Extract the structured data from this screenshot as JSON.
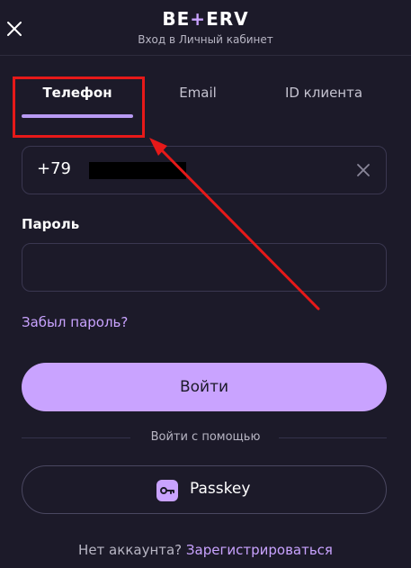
{
  "header": {
    "logo_text_left": "BE",
    "logo_plus": "+",
    "logo_text_right": "ERV",
    "subtitle": "Вход в Личный кабинет"
  },
  "tabs": [
    {
      "label": "Телефон",
      "active": true
    },
    {
      "label": "Email",
      "active": false
    },
    {
      "label": "ID клиента",
      "active": false
    }
  ],
  "phone": {
    "prefix": "+79"
  },
  "password": {
    "label": "Пароль",
    "value": ""
  },
  "forgot_link": "Забыл пароль?",
  "login_button": "Войти",
  "divider_text": "Войти с помощью",
  "passkey_button": "Passkey",
  "footer": {
    "question": "Нет аккаунта?",
    "link": "Зарегистрироваться"
  },
  "colors": {
    "accent": "#c9a3ff",
    "background": "#1c1a29",
    "annotation": "#e61919"
  },
  "icons": [
    "close-icon",
    "clear-icon",
    "key-icon"
  ]
}
